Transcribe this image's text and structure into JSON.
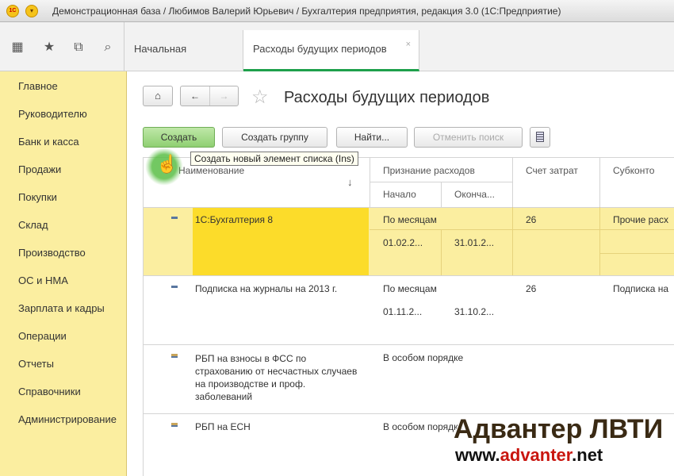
{
  "window": {
    "logo_text": "1С",
    "menu_glyph": "▾",
    "title": "Демонстрационная база / Любимов Валерий Юрьевич / Бухгалтерия предприятия, редакция 3.0  (1С:Предприятие)"
  },
  "toolbar": {
    "icons": [
      "apps-grid-icon",
      "favorites-star-icon",
      "history-icon",
      "search-icon"
    ],
    "glyphs": [
      "▦",
      "★",
      "⧉",
      "⌕"
    ]
  },
  "tabs": {
    "home": "Начальная страница",
    "active": "Расходы будущих периодов",
    "close_glyph": "×"
  },
  "sidebar": {
    "items": [
      {
        "label": "Главное"
      },
      {
        "label": "Руководителю"
      },
      {
        "label": "Банк и касса"
      },
      {
        "label": "Продажи"
      },
      {
        "label": "Покупки"
      },
      {
        "label": "Склад"
      },
      {
        "label": "Производство"
      },
      {
        "label": "ОС и НМА"
      },
      {
        "label": "Зарплата и кадры"
      },
      {
        "label": "Операции"
      },
      {
        "label": "Отчеты"
      },
      {
        "label": "Справочники"
      },
      {
        "label": "Администрирование"
      }
    ]
  },
  "header": {
    "home_glyph": "⌂",
    "back_glyph": "←",
    "forward_glyph": "→",
    "star_glyph": "☆",
    "title": "Расходы будущих периодов"
  },
  "buttons": {
    "create": "Создать",
    "create_group": "Создать группу",
    "find": "Найти...",
    "cancel_search": "Отменить поиск"
  },
  "tooltip": {
    "text": "Создать новый элемент списка (Ins)",
    "hand_glyph": "☝"
  },
  "table": {
    "columns": {
      "name": "Наименование",
      "sort_glyph": "↓",
      "recognition": "Признание расходов",
      "start": "Начало",
      "end": "Оконча...",
      "account": "Счет затрат",
      "subconto": "Субконто"
    },
    "rows": [
      {
        "name": "1С:Бухгалтерия 8",
        "method": "По месяцам",
        "start": "01.02.2...",
        "end": "31.01.2...",
        "account": "26",
        "subconto": "Прочие расх"
      },
      {
        "name": "Подписка на журналы на 2013 г.",
        "method": "По месяцам",
        "start": "01.11.2...",
        "end": "31.10.2...",
        "account": "26",
        "subconto": "Подписка на"
      },
      {
        "name": "РБП на взносы в ФСС по страхованию от несчастных случаев на производстве и проф. заболеваний",
        "method": "В особом порядке",
        "start": "",
        "end": "",
        "account": "",
        "subconto": ""
      },
      {
        "name": "РБП на ЕСН",
        "method": "В особом порядке",
        "start": "",
        "end": "",
        "account": "",
        "subconto": ""
      }
    ]
  },
  "watermark": {
    "line1": "Адвантер ЛВТИ",
    "line2_prefix": "www.",
    "line2_accent": "advanter",
    "line2_suffix": ".net"
  }
}
